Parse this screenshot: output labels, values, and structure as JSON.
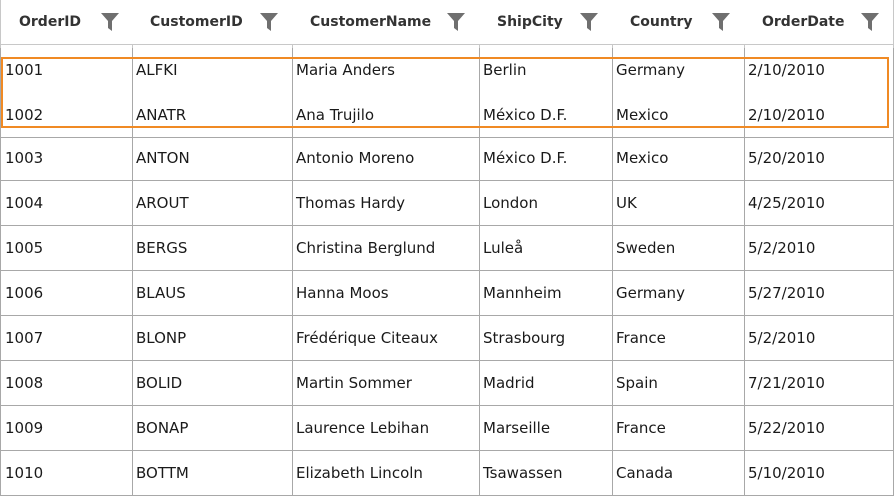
{
  "grid": {
    "columns": [
      {
        "label": "OrderID",
        "name": "orderid"
      },
      {
        "label": "CustomerID",
        "name": "customerid"
      },
      {
        "label": "CustomerName",
        "name": "customername"
      },
      {
        "label": "ShipCity",
        "name": "shipcity"
      },
      {
        "label": "Country",
        "name": "country"
      },
      {
        "label": "OrderDate",
        "name": "orderdate"
      }
    ],
    "filter_icon": "filter-funnel-icon",
    "selection_color": "#f08a24",
    "selected_rows": [
      "1001",
      "1002"
    ],
    "rows": [
      [
        "1001",
        "ALFKI",
        "Maria Anders",
        "Berlin",
        "Germany",
        "2/10/2010"
      ],
      [
        "1002",
        "ANATR",
        "Ana Trujilo",
        "México D.F.",
        "Mexico",
        "2/10/2010"
      ],
      [
        "1003",
        "ANTON",
        "Antonio Moreno",
        "México D.F.",
        "Mexico",
        "5/20/2010"
      ],
      [
        "1004",
        "AROUT",
        "Thomas Hardy",
        "London",
        "UK",
        "4/25/2010"
      ],
      [
        "1005",
        "BERGS",
        "Christina Berglund",
        "Luleå",
        "Sweden",
        "5/2/2010"
      ],
      [
        "1006",
        "BLAUS",
        "Hanna Moos",
        "Mannheim",
        "Germany",
        "5/27/2010"
      ],
      [
        "1007",
        "BLONP",
        "Frédérique Citeaux",
        "Strasbourg",
        "France",
        "5/2/2010"
      ],
      [
        "1008",
        "BOLID",
        "Martin Sommer",
        "Madrid",
        "Spain",
        "7/21/2010"
      ],
      [
        "1009",
        "BONAP",
        "Laurence Lebihan",
        "Marseille",
        "France",
        "5/22/2010"
      ],
      [
        "1010",
        "BOTTM",
        "Elizabeth Lincoln",
        "Tsawassen",
        "Canada",
        "5/10/2010"
      ]
    ]
  }
}
